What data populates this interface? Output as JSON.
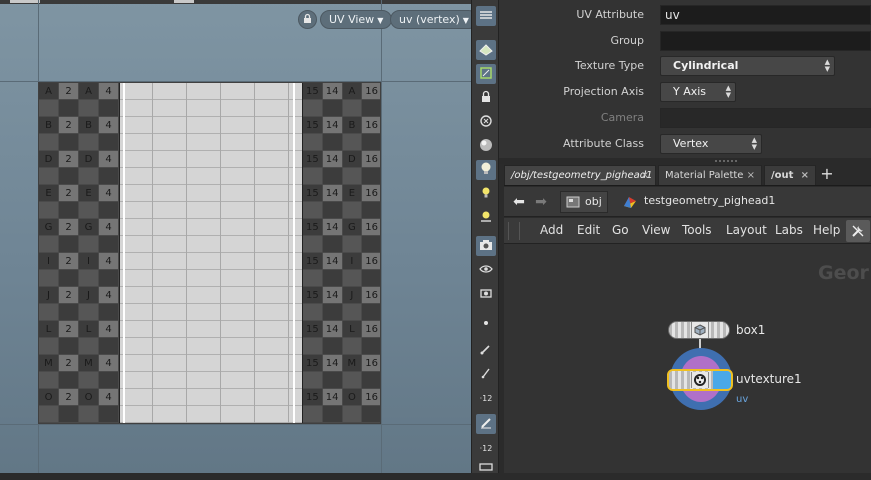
{
  "uv_viewport": {
    "view_menu_label": "UV View",
    "attribute_menu_label": "uv (vertex)",
    "checker_rows": [
      "A",
      "B",
      "C",
      "D",
      "E",
      "F",
      "G",
      "H",
      "I",
      "J",
      "K",
      "L",
      "M",
      "N",
      "O",
      "P"
    ],
    "checker_left_cols": [
      "",
      "2",
      "3",
      "4"
    ],
    "checker_right_cols": [
      "14",
      "15",
      "16"
    ]
  },
  "toolbar": {
    "tools": [
      {
        "icon": "display-options-icon",
        "active": true
      },
      {
        "icon": "texture-display-icon",
        "active": true
      },
      {
        "icon": "lock-camera-icon",
        "active": false
      },
      {
        "icon": "ghost-icon",
        "active": false
      },
      {
        "icon": "sphere-shading-icon",
        "active": false
      },
      {
        "icon": "light-bulb-icon",
        "active": true
      },
      {
        "icon": "headlight-icon",
        "active": false
      },
      {
        "icon": "light-add-icon",
        "active": false
      },
      {
        "icon": "camera-icon",
        "active": true
      },
      {
        "icon": "visibility-eye-icon",
        "active": false
      },
      {
        "icon": "snapshot-icon",
        "active": false
      },
      {
        "icon": "point-icon",
        "active": false
      },
      {
        "icon": "brush-icon",
        "active": false
      },
      {
        "icon": "pen-icon",
        "active": false
      },
      {
        "icon": "number-12-icon",
        "label": "12",
        "active": false
      },
      {
        "icon": "paint-icon",
        "active": true
      },
      {
        "icon": "number-12b-icon",
        "label": "12",
        "active": false
      },
      {
        "icon": "display-bar-icon",
        "active": false
      }
    ]
  },
  "parameters": {
    "uv_attribute": {
      "label": "UV Attribute",
      "value": "uv"
    },
    "group": {
      "label": "Group",
      "value": ""
    },
    "texture_type": {
      "label": "Texture Type",
      "value": "Cylindrical"
    },
    "projection_axis": {
      "label": "Projection Axis",
      "value": "Y Axis"
    },
    "camera": {
      "label": "Camera",
      "value": ""
    },
    "attribute_class": {
      "label": "Attribute Class",
      "value": "Vertex"
    }
  },
  "network": {
    "tabs": [
      {
        "label": "/obj/testgeometry_pighead1",
        "close": "×"
      },
      {
        "label": "Material Palette",
        "close": "×"
      },
      {
        "label": "/out",
        "close": "×"
      }
    ],
    "add_tab": "+",
    "path": {
      "obj": "obj",
      "node": "testgeometry_pighead1"
    },
    "menu": [
      "Add",
      "Edit",
      "Go",
      "View",
      "Tools",
      "Layout",
      "Labs",
      "Help"
    ],
    "context_label": "Geor",
    "nodes": [
      {
        "name": "box1",
        "subtitle": ""
      },
      {
        "name": "uvtexture1",
        "subtitle": "uv"
      }
    ]
  },
  "colors": {
    "accent_blue": "#6aa6e0",
    "node_select_yellow": "#f0c020",
    "node_ring_purple": "#b070c8",
    "node_ring_blue": "#3f6fb0"
  }
}
